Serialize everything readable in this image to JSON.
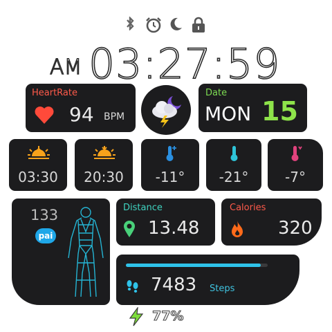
{
  "status_icons": [
    "bluetooth-icon",
    "alarm-icon",
    "moon-icon",
    "lock-icon"
  ],
  "time": {
    "ampm": "AM",
    "clock": "03:27:59"
  },
  "heart": {
    "label": "HeartRate",
    "value": "94",
    "unit": "BPM",
    "color": "#ff4a3a"
  },
  "weather": {
    "icon": "thunder-cloud-moon-icon"
  },
  "date": {
    "label": "Date",
    "day": "MON",
    "num": "15",
    "accent": "#8ee34a"
  },
  "mini": {
    "sunrise": "03:30",
    "sunset": "20:30",
    "temp1": "-11°",
    "temp2": "-21°",
    "temp3": "-7°"
  },
  "pai": {
    "value": "133",
    "badge": "pai"
  },
  "distance": {
    "label": "Distance",
    "value": "13.48"
  },
  "calories": {
    "label": "Calories",
    "value": "320"
  },
  "steps": {
    "value": "7483",
    "label": "Steps",
    "progress": 0.95
  },
  "battery": {
    "value": "77%"
  },
  "colors": {
    "teal": "#2fc3ea",
    "orange": "#ff6a1a",
    "green": "#49d17a"
  }
}
